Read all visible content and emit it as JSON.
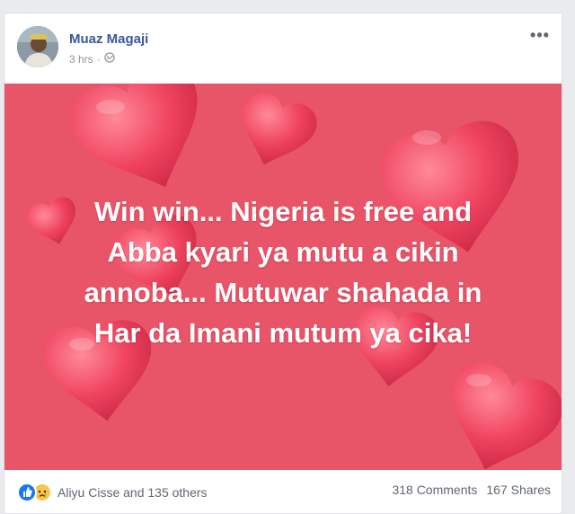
{
  "post": {
    "author": "Muaz Magaji",
    "time": "3 hrs",
    "separator": "·",
    "more_label": "•••",
    "image_text": [
      "Win win... Nigeria is free and",
      "Abba kyari ya mutu a cikin",
      "annoba... Mutuwar shahada in",
      "Har da Imani mutum ya cika!"
    ],
    "reactions_text": "Aliyu Cisse and 135 others",
    "comments": "318 Comments",
    "shares": "167 Shares",
    "icons": {
      "privacy": "globe-icon",
      "more": "more-options-icon",
      "reactions": [
        "like-icon",
        "sad-icon"
      ]
    },
    "colors": {
      "author": "#385898",
      "image_background": "#e85569",
      "heart": "#f04460",
      "like": "#1877f2"
    }
  }
}
